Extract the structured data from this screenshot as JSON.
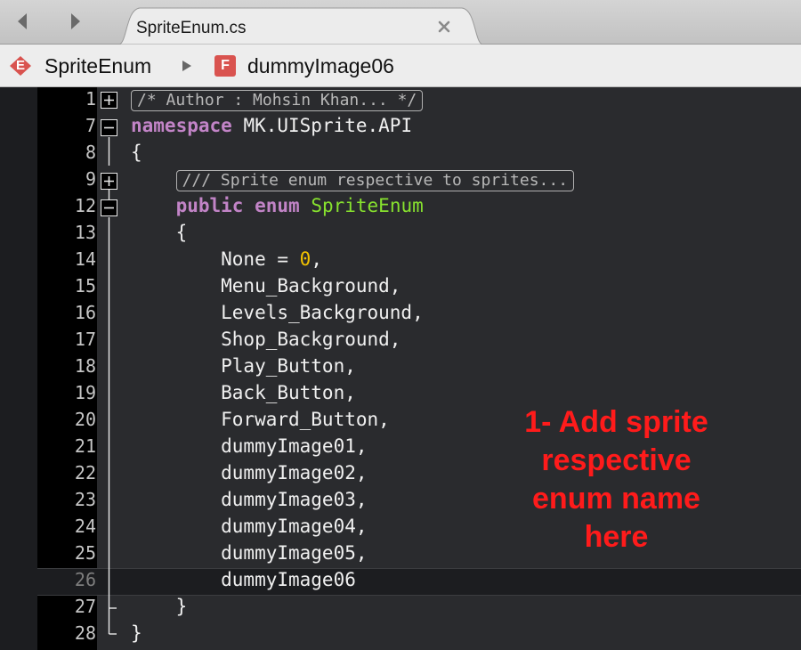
{
  "tab": {
    "title": "SpriteEnum.cs"
  },
  "breadcrumb": {
    "enum_badge": "E",
    "enum_name": "SpriteEnum",
    "field_badge": "F",
    "field_name": "dummyImage06"
  },
  "editor": {
    "lines": [
      {
        "num": "1",
        "tokens": [
          {
            "text": "/* Author : Mohsin Khan... */",
            "style": "fold-comment"
          }
        ]
      },
      {
        "num": "7",
        "tokens": [
          {
            "text": "namespace",
            "style": "kw"
          },
          {
            "text": " MK.UISprite.API",
            "style": "plain"
          }
        ]
      },
      {
        "num": "8",
        "tokens": [
          {
            "text": "{",
            "style": "plain"
          }
        ]
      },
      {
        "num": "9",
        "tokens": [
          {
            "text": "    ",
            "style": "plain"
          },
          {
            "text": "/// Sprite enum respective to sprites...",
            "style": "fold-comment"
          }
        ]
      },
      {
        "num": "12",
        "tokens": [
          {
            "text": "    ",
            "style": "plain"
          },
          {
            "text": "public",
            "style": "kw"
          },
          {
            "text": " ",
            "style": "plain"
          },
          {
            "text": "enum",
            "style": "kw"
          },
          {
            "text": " ",
            "style": "plain"
          },
          {
            "text": "SpriteEnum",
            "style": "type"
          }
        ]
      },
      {
        "num": "13",
        "tokens": [
          {
            "text": "    {",
            "style": "plain"
          }
        ]
      },
      {
        "num": "14",
        "tokens": [
          {
            "text": "        None = ",
            "style": "plain"
          },
          {
            "text": "0",
            "style": "num"
          },
          {
            "text": ",",
            "style": "plain"
          }
        ]
      },
      {
        "num": "15",
        "tokens": [
          {
            "text": "        Menu_Background,",
            "style": "plain"
          }
        ]
      },
      {
        "num": "16",
        "tokens": [
          {
            "text": "        Levels_Background,",
            "style": "plain"
          }
        ]
      },
      {
        "num": "17",
        "tokens": [
          {
            "text": "        Shop_Background,",
            "style": "plain"
          }
        ]
      },
      {
        "num": "18",
        "tokens": [
          {
            "text": "        Play_Button,",
            "style": "plain"
          }
        ]
      },
      {
        "num": "19",
        "tokens": [
          {
            "text": "        Back_Button,",
            "style": "plain"
          }
        ]
      },
      {
        "num": "20",
        "tokens": [
          {
            "text": "        Forward_Button,",
            "style": "plain"
          }
        ]
      },
      {
        "num": "21",
        "tokens": [
          {
            "text": "        dummyImage01,",
            "style": "plain"
          }
        ]
      },
      {
        "num": "22",
        "tokens": [
          {
            "text": "        dummyImage02,",
            "style": "plain"
          }
        ]
      },
      {
        "num": "23",
        "tokens": [
          {
            "text": "        dummyImage03,",
            "style": "plain"
          }
        ]
      },
      {
        "num": "24",
        "tokens": [
          {
            "text": "        dummyImage04,",
            "style": "plain"
          }
        ]
      },
      {
        "num": "25",
        "tokens": [
          {
            "text": "        dummyImage05,",
            "style": "plain"
          }
        ]
      },
      {
        "num": "26",
        "tokens": [
          {
            "text": "        dummyImage06",
            "style": "plain"
          }
        ],
        "current": true
      },
      {
        "num": "27",
        "tokens": [
          {
            "text": "    }",
            "style": "plain"
          }
        ]
      },
      {
        "num": "28",
        "tokens": [
          {
            "text": "}",
            "style": "plain"
          }
        ]
      }
    ]
  },
  "annotation": {
    "lines": [
      "1- Add sprite",
      "respective",
      "enum name",
      "here"
    ]
  },
  "colors": {
    "keyword": "#c284c7",
    "type": "#87e22e",
    "number": "#f2c200",
    "annotation": "#ff1b1b",
    "enum_badge": "#d9534f",
    "field_badge": "#d9534f"
  }
}
